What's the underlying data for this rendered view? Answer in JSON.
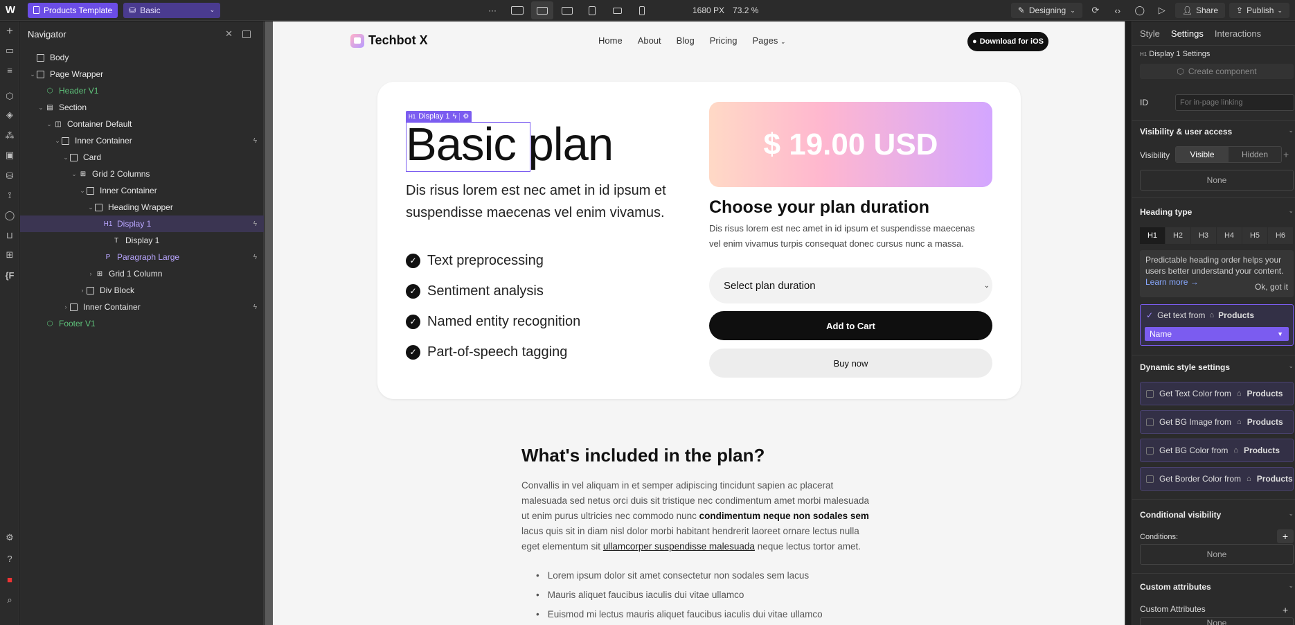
{
  "topbar": {
    "template_label": "Products Template",
    "page_label": "Basic",
    "more": "···",
    "width": "1680 PX",
    "zoom": "73.2 %",
    "mode": "Designing",
    "share": "Share",
    "publish": "Publish"
  },
  "navigator": {
    "title": "Navigator",
    "items": [
      {
        "label": "Body"
      },
      {
        "label": "Page Wrapper"
      },
      {
        "label": "Header V1"
      },
      {
        "label": "Section"
      },
      {
        "label": "Container Default"
      },
      {
        "label": "Inner Container"
      },
      {
        "label": "Card"
      },
      {
        "label": "Grid 2 Columns"
      },
      {
        "label": "Inner Container"
      },
      {
        "label": "Heading Wrapper"
      },
      {
        "label": "Display 1"
      },
      {
        "label": "Display 1"
      },
      {
        "label": "Paragraph Large"
      },
      {
        "label": "Grid 1 Column"
      },
      {
        "label": "Div Block"
      },
      {
        "label": "Inner Container"
      },
      {
        "label": "Footer V1"
      }
    ]
  },
  "site": {
    "brand": "Techbot X",
    "links": [
      "Home",
      "About",
      "Blog",
      "Pricing",
      "Pages"
    ],
    "download": "Download for iOS",
    "badge": "Display 1",
    "heading_word1": "Basic",
    "heading_word2": "plan",
    "lead": "Dis risus lorem est nec amet in id ipsum et suspendisse maecenas vel enim vivamus.",
    "features": [
      "Text preprocessing",
      "Sentiment analysis",
      "Named entity recognition",
      "Part-of-speech tagging"
    ],
    "price": "$ 19.00 USD",
    "plan_heading": "Choose your plan duration",
    "plan_text": "Dis risus lorem est nec amet in id ipsum et suspendisse maecenas vel enim vivamus turpis consequat donec cursus nunc a massa.",
    "select": "Select plan duration",
    "add_to_cart": "Add to Cart",
    "buy_now": "Buy now",
    "included_heading": "What's included in the plan?",
    "included_p1": "Convallis in vel aliquam in et semper adipiscing tincidunt sapien ac placerat malesuada sed netus orci duis sit tristique nec condimentum amet morbi malesuada ut enim purus ultricies nec commodo nunc ",
    "included_bold": "condimentum neque non sodales sem",
    "included_p2": " lacus quis sit in diam nisl dolor morbi habitant hendrerit laoreet ornare lectus nulla eget elementum sit ",
    "included_link": "ullamcorper suspendisse malesuada",
    "included_p3": " neque lectus tortor amet.",
    "bullets": [
      "Lorem ipsum dolor sit amet consectetur non sodales sem lacus",
      "Mauris aliquet faucibus iaculis dui vitae ullamco",
      "Euismod mi lectus mauris aliquet faucibus iaculis dui vitae ullamco"
    ]
  },
  "panel": {
    "tabs": [
      "Style",
      "Settings",
      "Interactions"
    ],
    "element_title": "Display 1 Settings",
    "create_component": "Create component",
    "id_label": "ID",
    "id_placeholder": "For in-page linking",
    "visibility_section": "Visibility & user access",
    "visibility_label": "Visibility",
    "visible": "Visible",
    "hidden": "Hidden",
    "none": "None",
    "heading_type": "Heading type",
    "h_levels": [
      "H1",
      "H2",
      "H3",
      "H4",
      "H5",
      "H6"
    ],
    "tip": "Predictable heading order helps your users better understand your content.",
    "learn_more": "Learn more →",
    "ok": "Ok, got it",
    "get_text_from": "Get text from",
    "products": "Products",
    "field_name": "Name",
    "dynamic_style": "Dynamic style settings",
    "dyn_items": [
      "Get Text Color from",
      "Get BG Image from",
      "Get BG Color from",
      "Get Border Color from"
    ],
    "conditional_visibility": "Conditional visibility",
    "conditions": "Conditions:",
    "custom_attributes_section": "Custom attributes",
    "custom_attributes": "Custom Attributes"
  }
}
